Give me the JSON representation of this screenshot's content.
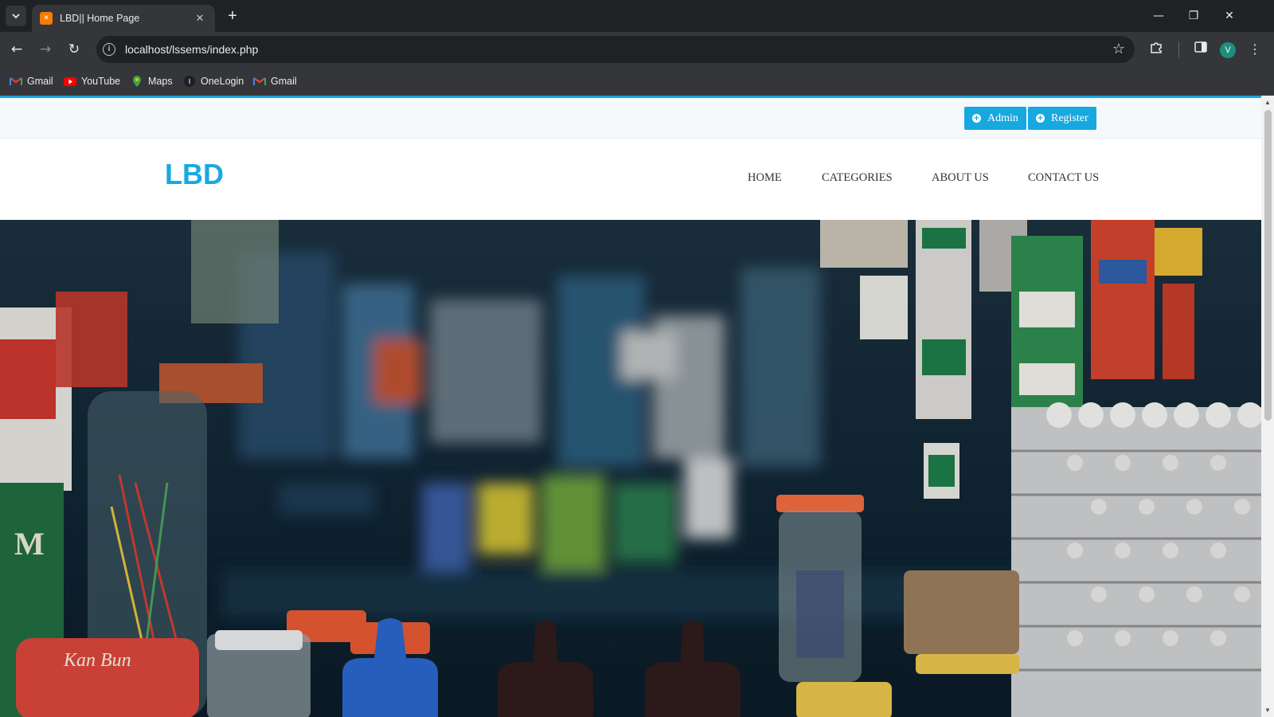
{
  "browser": {
    "tab": {
      "title": "LBD|| Home Page",
      "favicon": "xampp-icon"
    },
    "url": "localhost/lssems/index.php",
    "profile_initial": "V",
    "bookmarks": [
      {
        "label": "Gmail",
        "icon": "gmail-icon"
      },
      {
        "label": "YouTube",
        "icon": "youtube-icon"
      },
      {
        "label": "Maps",
        "icon": "maps-icon"
      },
      {
        "label": "OneLogin",
        "icon": "onelogin-icon"
      },
      {
        "label": "Gmail",
        "icon": "gmail-icon"
      }
    ]
  },
  "site": {
    "top_buttons": {
      "admin": "Admin",
      "register": "Register"
    },
    "logo": "LBD",
    "nav": {
      "home": "HOME",
      "categories": "CATEGORIES",
      "about": "ABOUT US",
      "contact": "CONTACT US"
    },
    "hero": {
      "description": "grocery store shelves background image",
      "accent": "#17a8e0"
    }
  }
}
